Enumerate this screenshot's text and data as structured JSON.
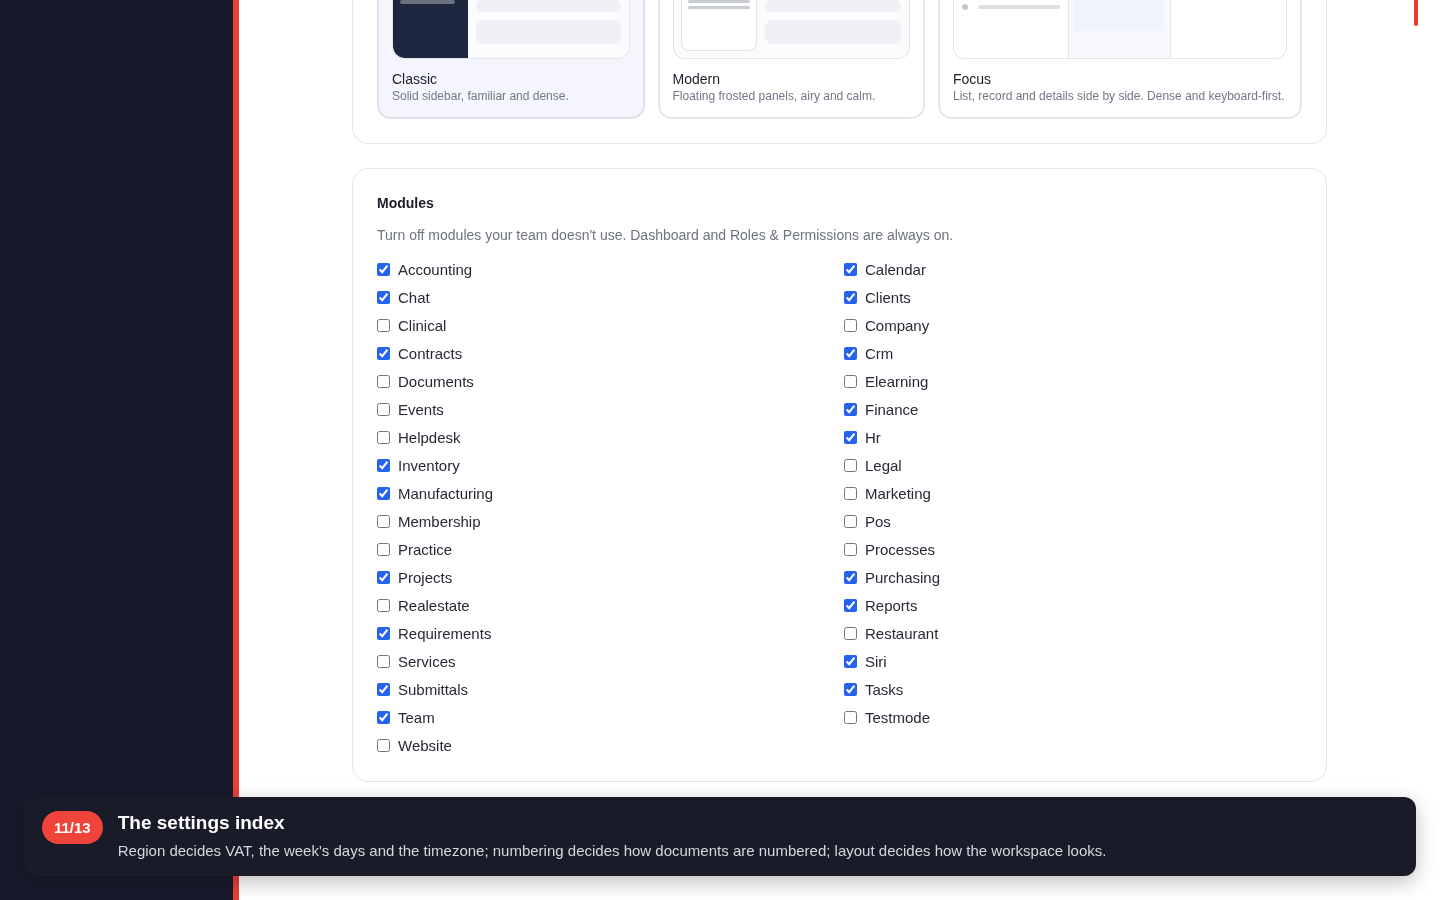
{
  "layouts": [
    {
      "kind": "classic",
      "name": "Classic",
      "description": "Solid sidebar, familiar and dense.",
      "selected": true
    },
    {
      "kind": "modern",
      "name": "Modern",
      "description": "Floating frosted panels, airy and calm.",
      "selected": false
    },
    {
      "kind": "focus",
      "name": "Focus",
      "description": "List, record and details side by side. Dense and keyboard-first.",
      "selected": false
    }
  ],
  "modules": {
    "title": "Modules",
    "description": "Turn off modules your team doesn't use. Dashboard and Roles & Permissions are always on.",
    "items": [
      {
        "label": "Accounting",
        "checked": true
      },
      {
        "label": "Calendar",
        "checked": true
      },
      {
        "label": "Chat",
        "checked": true
      },
      {
        "label": "Clients",
        "checked": true
      },
      {
        "label": "Clinical",
        "checked": false
      },
      {
        "label": "Company",
        "checked": false
      },
      {
        "label": "Contracts",
        "checked": true
      },
      {
        "label": "Crm",
        "checked": true
      },
      {
        "label": "Documents",
        "checked": false
      },
      {
        "label": "Elearning",
        "checked": false
      },
      {
        "label": "Events",
        "checked": false
      },
      {
        "label": "Finance",
        "checked": true
      },
      {
        "label": "Helpdesk",
        "checked": false
      },
      {
        "label": "Hr",
        "checked": true
      },
      {
        "label": "Inventory",
        "checked": true
      },
      {
        "label": "Legal",
        "checked": false
      },
      {
        "label": "Manufacturing",
        "checked": true
      },
      {
        "label": "Marketing",
        "checked": false
      },
      {
        "label": "Membership",
        "checked": false
      },
      {
        "label": "Pos",
        "checked": false
      },
      {
        "label": "Practice",
        "checked": false
      },
      {
        "label": "Processes",
        "checked": false
      },
      {
        "label": "Projects",
        "checked": true
      },
      {
        "label": "Purchasing",
        "checked": true
      },
      {
        "label": "Realestate",
        "checked": false
      },
      {
        "label": "Reports",
        "checked": true
      },
      {
        "label": "Requirements",
        "checked": true
      },
      {
        "label": "Restaurant",
        "checked": false
      },
      {
        "label": "Services",
        "checked": false
      },
      {
        "label": "Siri",
        "checked": true
      },
      {
        "label": "Submittals",
        "checked": true
      },
      {
        "label": "Tasks",
        "checked": true
      },
      {
        "label": "Team",
        "checked": true
      },
      {
        "label": "Testmode",
        "checked": false
      },
      {
        "label": "Website",
        "checked": false
      }
    ]
  },
  "tour": {
    "step": "11/13",
    "title": "The settings index",
    "text": "Region decides VAT, the week's days and the timezone; numbering decides how documents are numbered; layout decides how the workspace looks."
  }
}
